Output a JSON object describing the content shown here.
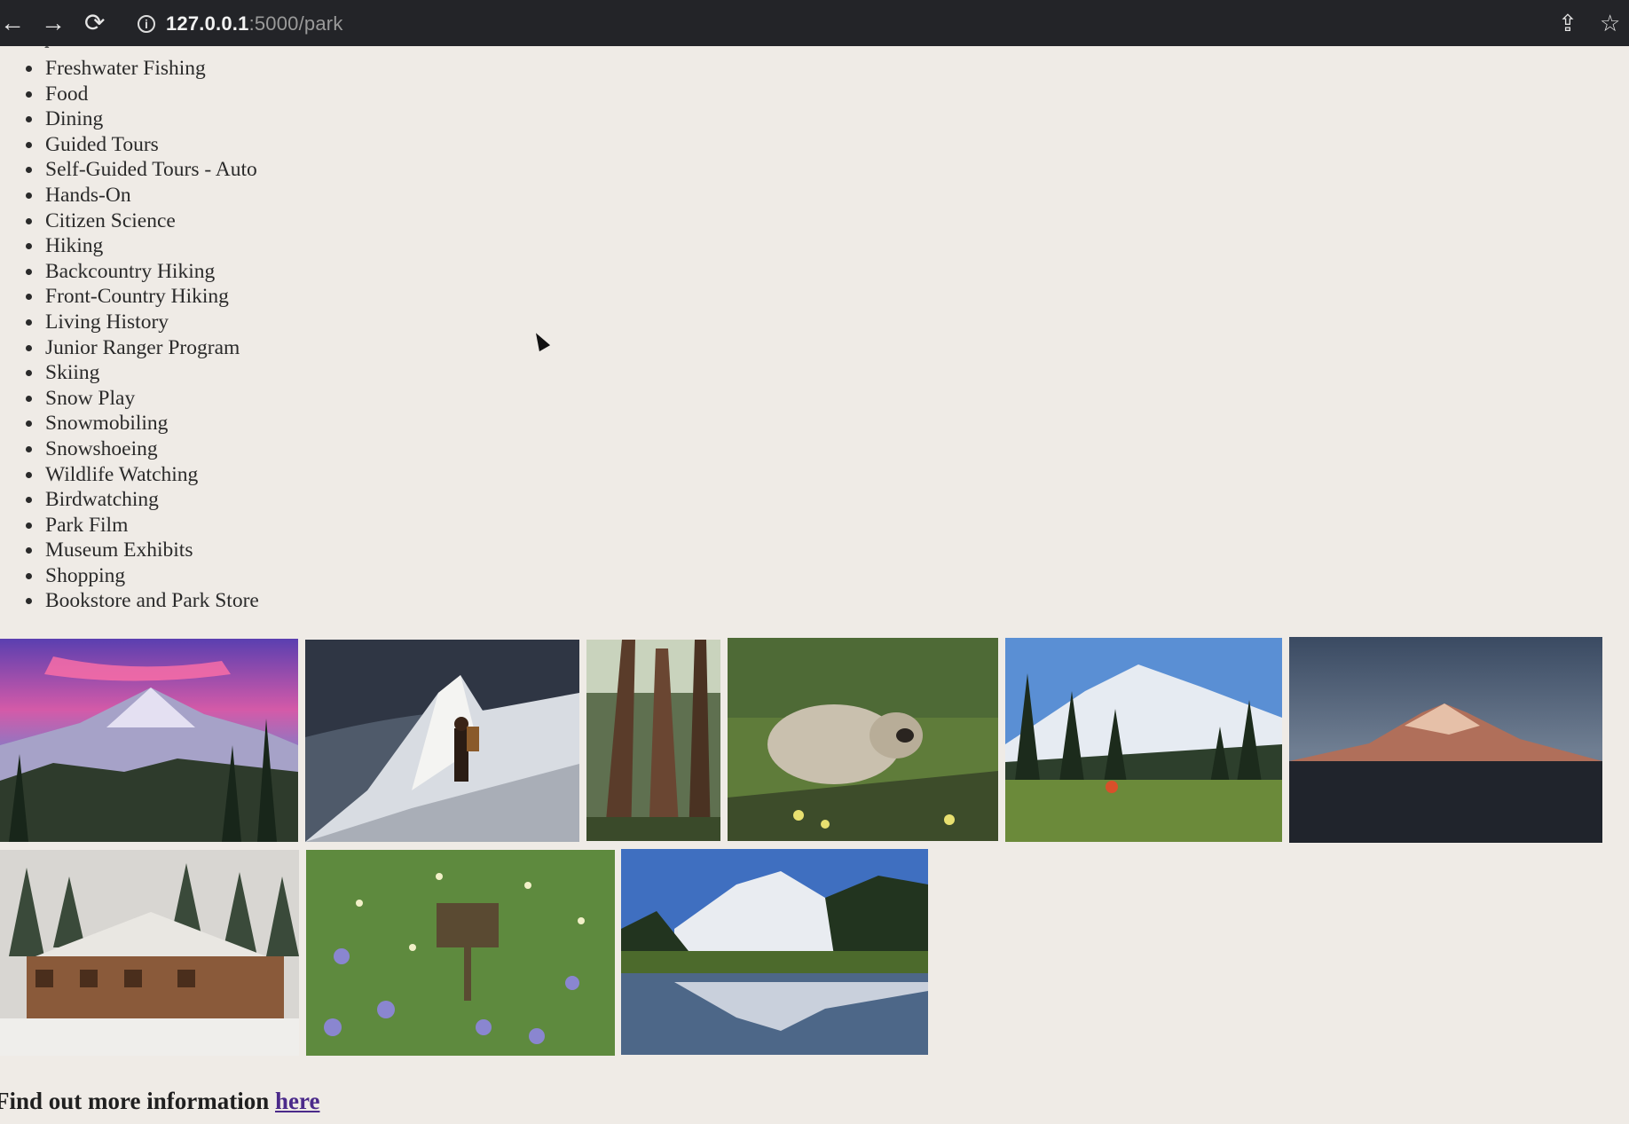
{
  "browser": {
    "back_icon": "←",
    "forward_icon": "→",
    "reload_icon": "⟳",
    "info_icon": "i",
    "url_host": "127.0.0.1",
    "url_rest": ":5000/park",
    "share_icon": "⇪",
    "bookmark_icon": "☆"
  },
  "activities": [
    "Freshwater Fishing",
    "Food",
    "Dining",
    "Guided Tours",
    "Self-Guided Tours - Auto",
    "Hands-On",
    "Citizen Science",
    "Hiking",
    "Backcountry Hiking",
    "Front-Country Hiking",
    "Living History",
    "Junior Ranger Program",
    "Skiing",
    "Snow Play",
    "Snowmobiling",
    "Snowshoeing",
    "Wildlife Watching",
    "Birdwatching",
    "Park Film",
    "Museum Exhibits",
    "Shopping",
    "Bookstore and Park Store"
  ],
  "footer": {
    "text": "Find out more information ",
    "link": "here"
  }
}
